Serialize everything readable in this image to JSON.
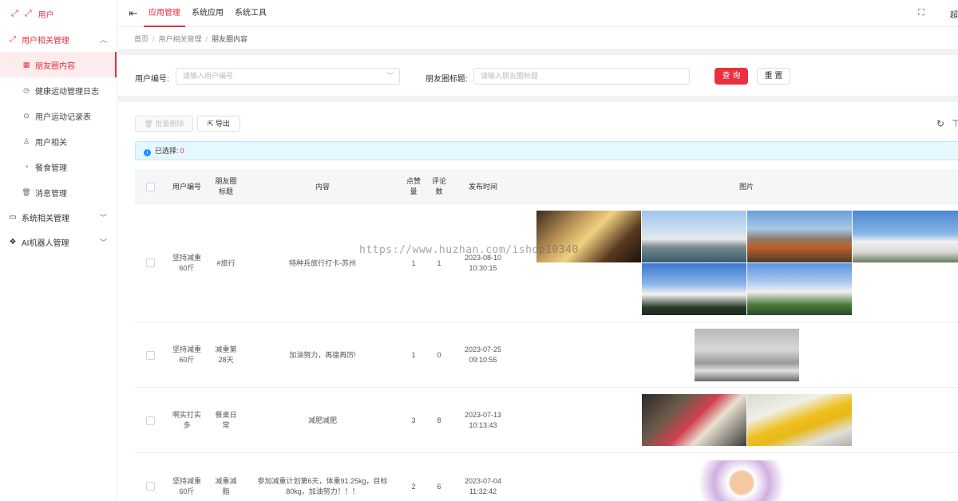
{
  "brand": {
    "text": "用户"
  },
  "sidebar": {
    "group_user": "用户相关管理",
    "items": [
      {
        "label": "朋友圈内容",
        "icon": "grid-icon"
      },
      {
        "label": "健康运动管理日志",
        "icon": "clock-icon"
      },
      {
        "label": "用户运动记录表",
        "icon": "play-circle-icon"
      },
      {
        "label": "用户相关",
        "icon": "user-icon"
      },
      {
        "label": "餐食管理",
        "icon": "dashboard-icon"
      },
      {
        "label": "消息管理",
        "icon": "trash-icon"
      }
    ],
    "group_system": "系统相关管理",
    "group_ai": "AI机器人管理"
  },
  "topbar": {
    "tabs": [
      "应用管理",
      "系统应用",
      "系统工具"
    ],
    "user_cut": "超"
  },
  "breadcrumb": [
    "首页",
    "用户相关管理",
    "朋友圈内容"
  ],
  "search": {
    "user_label": "用户编号:",
    "user_placeholder": "请输入用户编号",
    "title_label": "朋友圈标题:",
    "title_placeholder": "请输入朋友圈标题",
    "query": "查 询",
    "reset": "重 置"
  },
  "toolbar": {
    "batch_delete": "批量删除",
    "export": "导出"
  },
  "alert": {
    "text": "已选择:",
    "count": "0"
  },
  "table": {
    "headers": {
      "user": "用户编号",
      "title_1": "朋友圈",
      "title_2": "标题",
      "content": "内容",
      "likes_1": "点赞",
      "likes_2": "量",
      "comments_1": "评论",
      "comments_2": "数",
      "time": "发布时间",
      "images": "图片"
    },
    "rows": [
      {
        "user_1": "坚持减重",
        "user_2": "60斤",
        "title_1": "#旅行",
        "title_2": "",
        "content_1": "特种兵旅行打卡-苏州",
        "content_2": "",
        "likes": "1",
        "comments": "1",
        "date": "2023-08-10",
        "time": "10:30:15"
      },
      {
        "user_1": "坚持减重",
        "user_2": "60斤",
        "title_1": "减重第",
        "title_2": "28天",
        "content_1": "加油努力，再接再厉!",
        "content_2": "",
        "likes": "1",
        "comments": "0",
        "date": "2023-07-25",
        "time": "09:10:55"
      },
      {
        "user_1": "啊实打实",
        "user_2": "多",
        "title_1": "餐桌日",
        "title_2": "常",
        "content_1": "减肥减肥",
        "content_2": "",
        "likes": "3",
        "comments": "8",
        "date": "2023-07-13",
        "time": "10:13:43"
      },
      {
        "user_1": "坚持减重",
        "user_2": "60斤",
        "title_1": "减重减",
        "title_2": "脂",
        "content_1": "参加减重计划第6天，体重91.25kg，目标",
        "content_2": "80kg，加油努力！！！",
        "likes": "2",
        "comments": "6",
        "date": "2023-07-04",
        "time": "11:32:42"
      }
    ]
  },
  "watermark": "https://www.huzhan.com/ishop10340",
  "colors": {
    "accent": "#e8303f",
    "band": "#f0f2f5",
    "alert_bg": "#e6f7ff"
  }
}
